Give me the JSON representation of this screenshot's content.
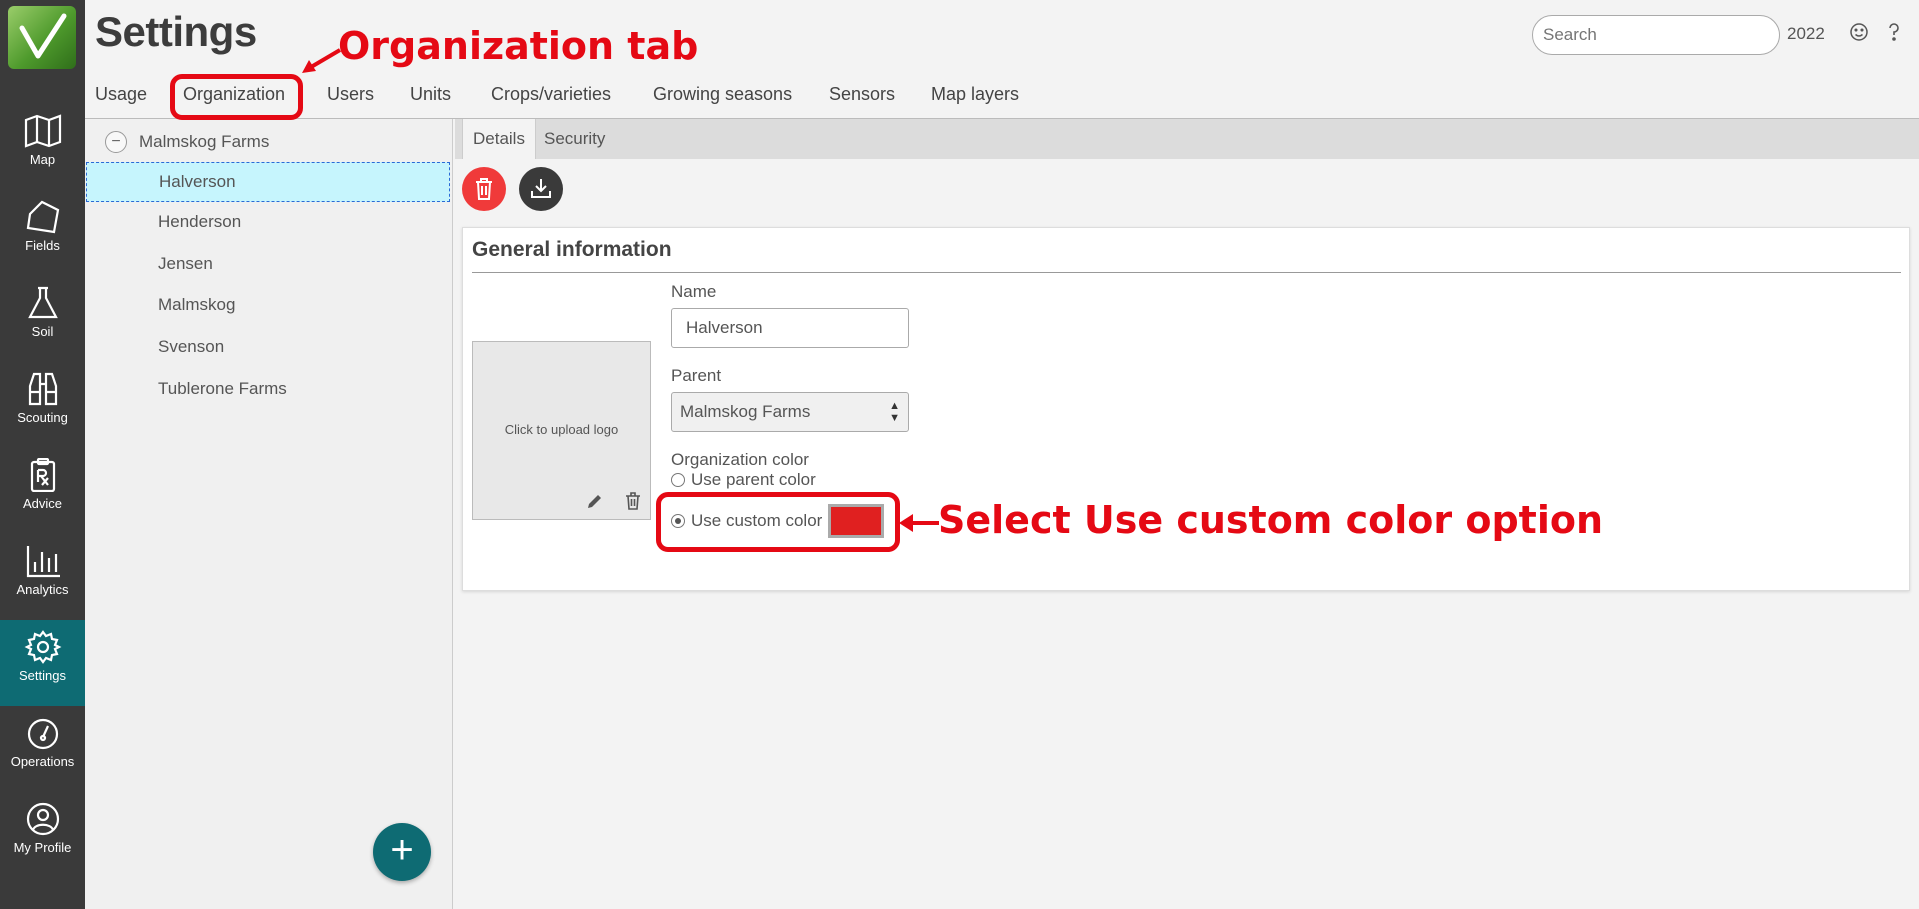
{
  "page": {
    "title": "Settings"
  },
  "header": {
    "search_placeholder": "Search",
    "year": "2022"
  },
  "sidebar": {
    "items": [
      {
        "label": "Map"
      },
      {
        "label": "Fields"
      },
      {
        "label": "Soil"
      },
      {
        "label": "Scouting"
      },
      {
        "label": "Advice"
      },
      {
        "label": "Analytics"
      },
      {
        "label": "Settings",
        "active": true
      },
      {
        "label": "Operations"
      },
      {
        "label": "My Profile"
      }
    ]
  },
  "tabs": [
    {
      "label": "Usage"
    },
    {
      "label": "Organization",
      "active": true
    },
    {
      "label": "Users"
    },
    {
      "label": "Units"
    },
    {
      "label": "Crops/varieties"
    },
    {
      "label": "Growing seasons"
    },
    {
      "label": "Sensors"
    },
    {
      "label": "Map layers"
    }
  ],
  "tree": {
    "root": "Malmskog Farms",
    "collapse_symbol": "−",
    "items": [
      {
        "label": "Halverson",
        "selected": true
      },
      {
        "label": "Henderson"
      },
      {
        "label": "Jensen"
      },
      {
        "label": "Malmskog"
      },
      {
        "label": "Svenson"
      },
      {
        "label": "Tublerone Farms"
      }
    ],
    "add_symbol": "+"
  },
  "subtabs": [
    {
      "label": "Details",
      "active": true
    },
    {
      "label": "Security"
    }
  ],
  "card": {
    "title": "General information",
    "logo_text": "Click to upload logo",
    "name_label": "Name",
    "name_value": "Halverson",
    "parent_label": "Parent",
    "parent_value": "Malmskog Farms",
    "color_label": "Organization color",
    "option_parent": "Use parent color",
    "option_custom": "Use custom color",
    "selected_option": "Use custom color"
  },
  "annotations": {
    "tab_note": "Organization tab",
    "color_note": "Select Use custom color option"
  },
  "colors": {
    "sidebar_bg": "#3a3a3a",
    "active_teal": "#0e6b73",
    "selected_row": "#c6f5fd",
    "delete_red": "#f03a3a",
    "custom_swatch": "#e02020",
    "annotation_red": "#e50914"
  }
}
